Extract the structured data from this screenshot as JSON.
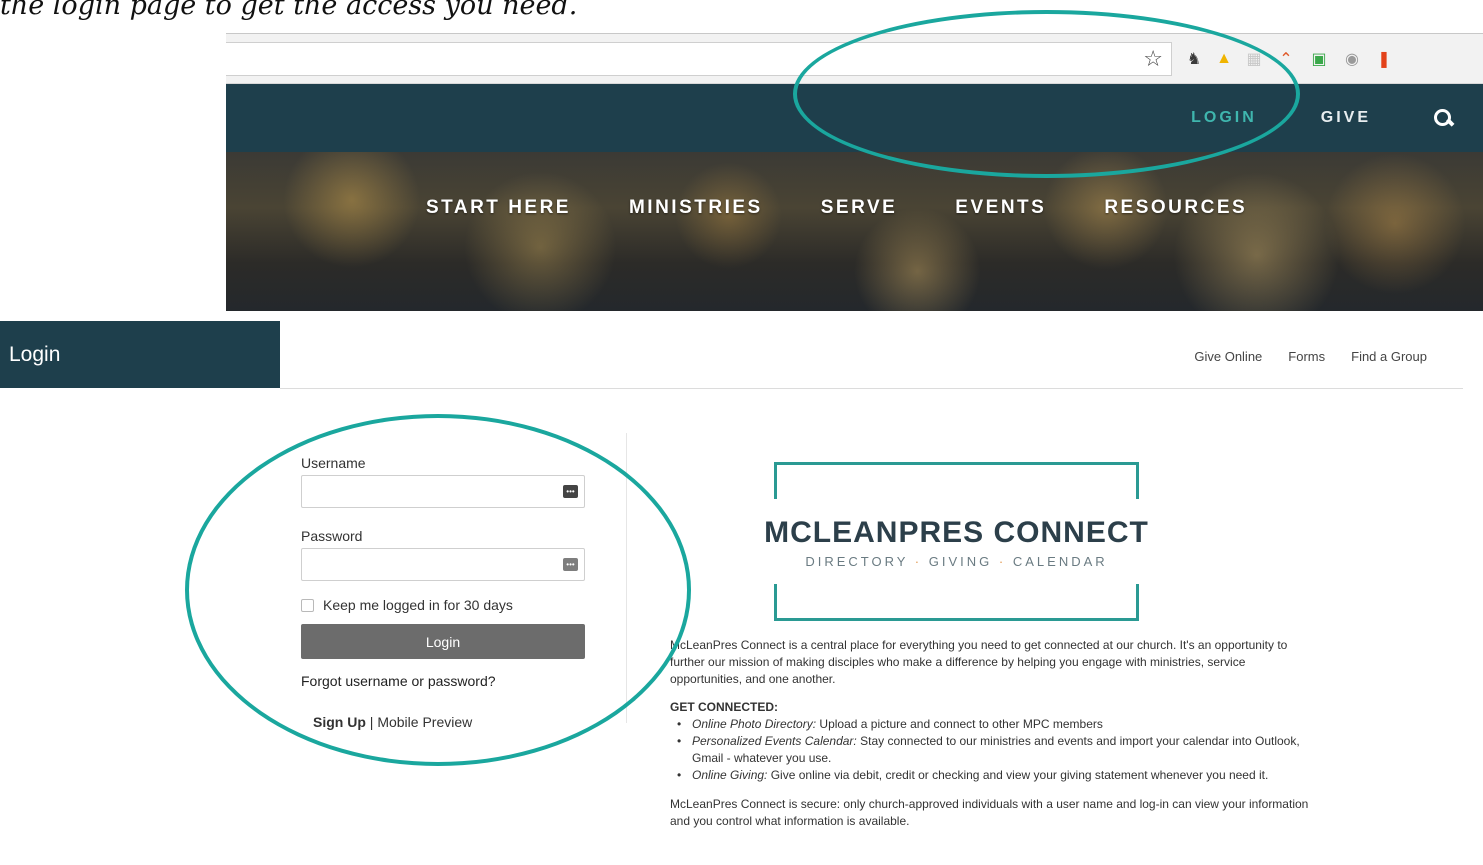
{
  "caption": "the login page to get the access you need.",
  "browser": {
    "extensions": [
      {
        "icon": "star-icon",
        "glyph": "☆"
      },
      {
        "icon": "evernote-icon",
        "glyph": "♞",
        "color": "#3a3a3a"
      },
      {
        "icon": "google-drive-icon",
        "glyph": "▲",
        "color": "#f0b400"
      },
      {
        "icon": "extension-generic-icon",
        "glyph": "▦",
        "color": "#c8c8c8"
      },
      {
        "icon": "reading-icon",
        "glyph": "⌃",
        "color": "#e05a2a"
      },
      {
        "icon": "green-extension-icon",
        "glyph": "▣",
        "color": "#3aa84a"
      },
      {
        "icon": "privacy-icon",
        "glyph": "◉",
        "color": "#9a9a9a"
      },
      {
        "icon": "office-icon",
        "glyph": "❚",
        "color": "#e3421a"
      }
    ]
  },
  "site": {
    "top_links": [
      {
        "label": "LOGIN"
      },
      {
        "label": "GIVE"
      }
    ],
    "hero_nav": [
      "START HERE",
      "MINISTRIES",
      "SERVE",
      "EVENTS",
      "RESOURCES"
    ]
  },
  "login_page": {
    "title": "Login",
    "top_links": [
      "Give Online",
      "Forms",
      "Find a Group"
    ],
    "form": {
      "username_label": "Username",
      "username_value": "",
      "password_label": "Password",
      "password_value": "",
      "keep_logged_in": "Keep me logged in for 30 days",
      "login_button": "Login",
      "forgot": "Forgot username or password?",
      "signup": "Sign Up",
      "separator": "|",
      "mobile_preview": "Mobile Preview"
    },
    "logo": {
      "title": "MCLEANPRES CONNECT",
      "sub_1": "DIRECTORY",
      "sub_2": "GIVING",
      "sub_3": "CALENDAR",
      "dot": "·"
    },
    "intro": "McLeanPres Connect is a central place for everything you need to get connected at our church. It's an opportunity to further our mission of making disciples who make a difference by helping you engage with ministries, service opportunities, and one another.",
    "get_connected_heading": "GET CONNECTED:",
    "bullets": [
      {
        "term": "Online Photo Directory:",
        "text": " Upload a picture and connect to other MPC members"
      },
      {
        "term": "Personalized Events Calendar:",
        "text": " Stay connected to our ministries and events and import your calendar into Outlook, Gmail - whatever you use."
      },
      {
        "term": "Online Giving:",
        "text": " Give online via debit, credit or checking and view your giving statement whenever you need it."
      }
    ],
    "secure": "McLeanPres Connect is secure: only church-approved individuals with a user name and log-in can view your information and you control what information is available."
  },
  "colors": {
    "navy": "#1e3f4c",
    "teal": "#3fb6ae",
    "highlight_ring": "#1aa79e",
    "button_grey": "#6c6c6c"
  }
}
